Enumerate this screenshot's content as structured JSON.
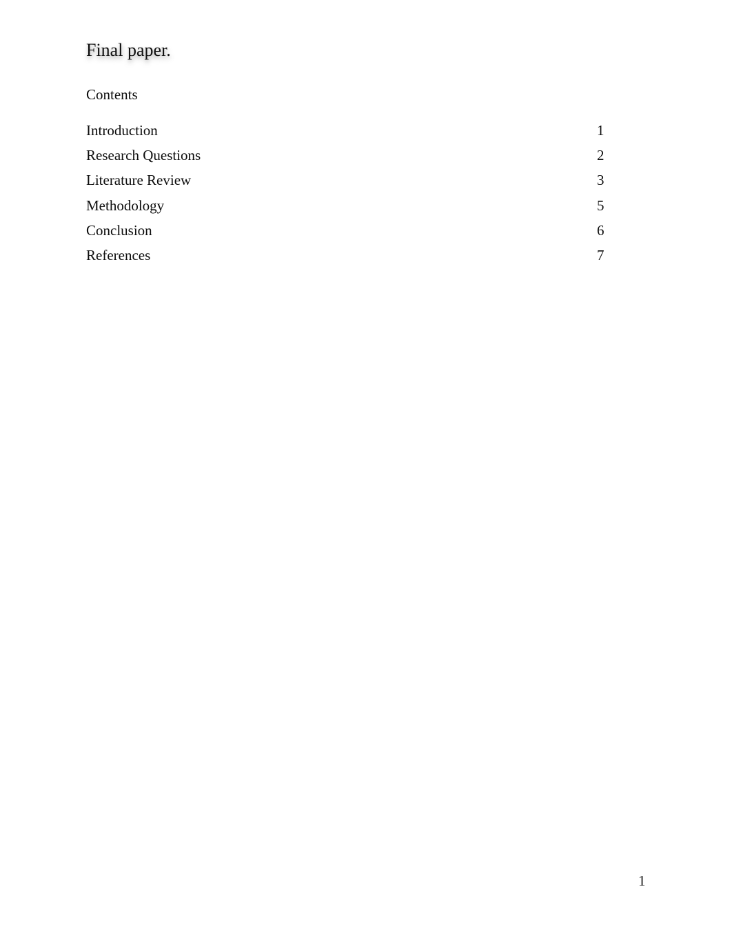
{
  "document": {
    "title": "Final paper.",
    "contents_heading": "Contents",
    "toc": [
      {
        "label": "Introduction",
        "page": "1"
      },
      {
        "label": "Research Questions",
        "page": "2"
      },
      {
        "label": "Literature Review",
        "page": "3"
      },
      {
        "label": "Methodology",
        "page": "5"
      },
      {
        "label": "Conclusion",
        "page": "6"
      },
      {
        "label": "References",
        "page": "7"
      }
    ],
    "footer": {
      "page_number": "1"
    }
  }
}
